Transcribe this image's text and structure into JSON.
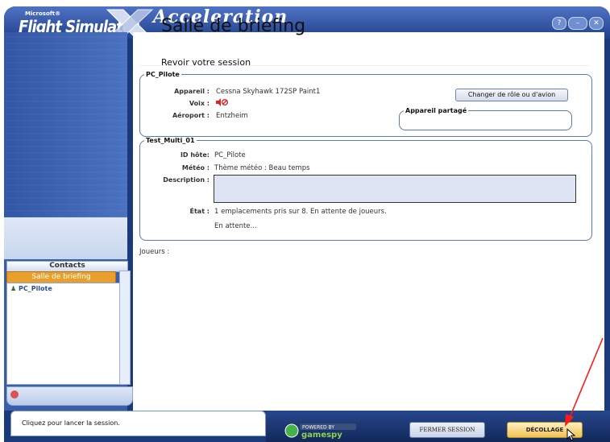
{
  "app": {
    "logo_small": "Microsoft®",
    "logo_main": "Flight Simulator",
    "logo_x": "X",
    "expansion": "Acceleration",
    "window_buttons": [
      "help-icon",
      "minimize-icon",
      "close-icon"
    ]
  },
  "page": {
    "title": "Salle de briefing",
    "subtitle": "Revoir votre session"
  },
  "pilot_group": {
    "legend": "PC_Pilote",
    "aircraft_label": "Appareil :",
    "aircraft_value": "Cessna Skyhawk 172SP Paint1",
    "voice_label": "Voix :",
    "voice_icon": "speaker-muted-icon",
    "airport_label": "Aéroport :",
    "airport_value": "Entzheim",
    "change_role_button": "Changer de rôle ou d'avion",
    "shared_aircraft_legend": "Appareil partagé"
  },
  "session_group": {
    "legend": "Test_Multi_01",
    "host_label": "ID hôte:",
    "host_value": "PC_Pilote",
    "weather_label": "Météo :",
    "weather_value": "Thème météo : Beau temps",
    "description_label": "Description :",
    "description_value": "",
    "state_label": "État :",
    "state_value": "1 emplacements pris sur 8. En attente de joueurs.",
    "waiting_text": "En attente..."
  },
  "players_label": "Joueurs :",
  "sidebar": {
    "contacts_header": "Contacts",
    "room_label": "Salle de briefing",
    "contacts": [
      {
        "name": "PC_Pilote",
        "icon": "pilot-icon"
      }
    ]
  },
  "status": {
    "text": "Cliquez pour lancer la session."
  },
  "footer": {
    "gamespy_top": "POWERED BY",
    "gamespy_brand": "gamespy",
    "end_session_button": "FERMER SESSION",
    "takeoff_button": "DÉCOLLAGE"
  },
  "colors": {
    "frame": "#1a3a7a",
    "accent_orange": "#e8a02a",
    "annotation_arrow": "#ff0000"
  }
}
